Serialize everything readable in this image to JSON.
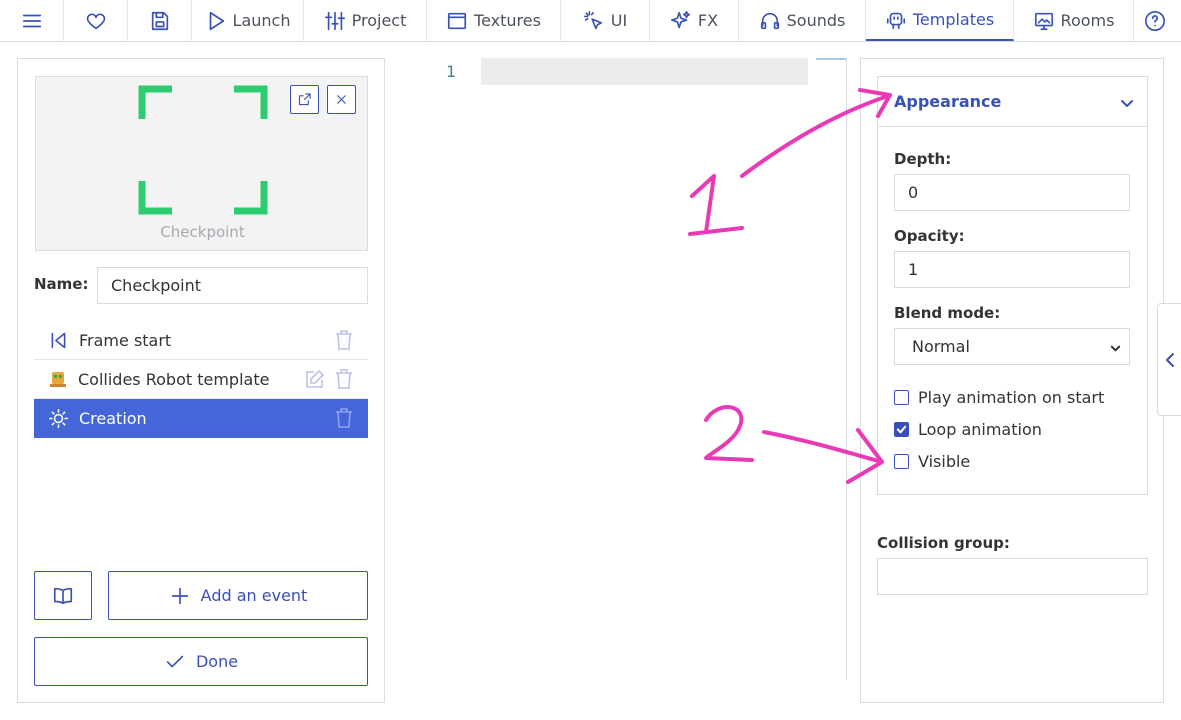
{
  "topbar": {
    "items": [
      {
        "icon": "hamburger-menu-icon",
        "label": ""
      },
      {
        "icon": "heart-icon",
        "label": ""
      },
      {
        "icon": "save-icon",
        "label": ""
      },
      {
        "icon": "play-icon",
        "label": "Launch"
      },
      {
        "icon": "sliders-icon",
        "label": "Project"
      },
      {
        "icon": "textures-icon",
        "label": "Textures"
      },
      {
        "icon": "cursor-click-icon",
        "label": "UI"
      },
      {
        "icon": "sparkles-icon",
        "label": "FX"
      },
      {
        "icon": "headphones-icon",
        "label": "Sounds"
      },
      {
        "icon": "robot-icon",
        "label": "Templates"
      },
      {
        "icon": "image-rooms-icon",
        "label": "Rooms"
      },
      {
        "icon": "help-icon",
        "label": ""
      }
    ],
    "active": "Templates"
  },
  "template": {
    "preview_caption": "Checkpoint",
    "name_label": "Name:",
    "name_value": "Checkpoint"
  },
  "events": [
    {
      "icon": "frame-start-icon",
      "label": "Frame start",
      "selected": false
    },
    {
      "icon": "robot-template-icon",
      "label": "Collides Robot template",
      "selected": false
    },
    {
      "icon": "sun-icon",
      "label": "Creation",
      "selected": true
    }
  ],
  "buttons": {
    "add_event": "Add an event",
    "done": "Done"
  },
  "editor": {
    "line_number": "1"
  },
  "appearance": {
    "title": "Appearance",
    "depth_label": "Depth:",
    "depth_value": "0",
    "opacity_label": "Opacity:",
    "opacity_value": "1",
    "blend_label": "Blend mode:",
    "blend_value": "Normal",
    "checkboxes": [
      {
        "label": "Play animation on start",
        "checked": false
      },
      {
        "label": "Loop animation",
        "checked": true
      },
      {
        "label": "Visible",
        "checked": false
      }
    ]
  },
  "collision": {
    "label": "Collision group:",
    "value": ""
  },
  "annotations": {
    "mark_1": "1",
    "mark_2": "2",
    "color": "#e93ab5"
  },
  "colors": {
    "accent": "#3a50b9",
    "selected_row": "#4566d8",
    "sprite_green": "#2ecc71"
  }
}
